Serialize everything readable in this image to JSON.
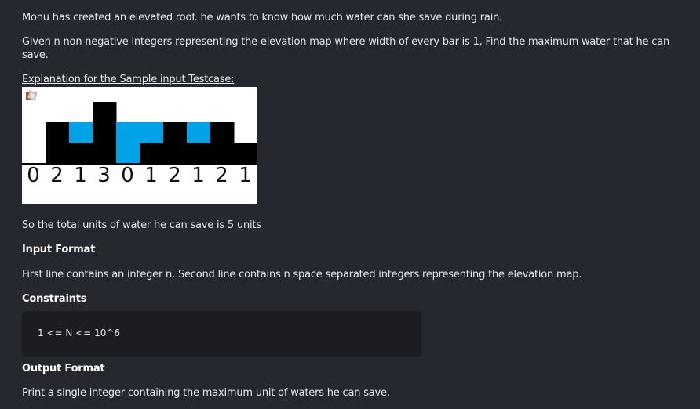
{
  "problem": {
    "intro": "Monu has created an elevated roof. he wants to know how much water can she save during rain.",
    "statement": "Given n non negative integers representing the elevation map where width of every bar is 1, Find the maximum water that he can save.",
    "explanation_heading": "Explanation for the Sample input Testcase:",
    "figure": {
      "heights": [
        0,
        2,
        1,
        3,
        0,
        1,
        2,
        1,
        2,
        1
      ],
      "labels": [
        "0",
        "2",
        "1",
        "3",
        "0",
        "1",
        "2",
        "1",
        "2",
        "1"
      ],
      "bar_color": "#000000",
      "water_color": "#00a2e8",
      "background": "#ffffff",
      "broken_image_icon": "broken-image-icon"
    },
    "total_text": "So the total units of water he can save is 5 units",
    "input_format": {
      "heading": "Input Format",
      "text": "First line contains an integer n. Second line contains n space separated integers representing the elevation map."
    },
    "constraints": {
      "heading": "Constraints",
      "code": "1 <= N <= 10^6"
    },
    "output_format": {
      "heading": "Output Format",
      "text": "Print a single integer containing the maximum unit of waters he can save."
    }
  }
}
